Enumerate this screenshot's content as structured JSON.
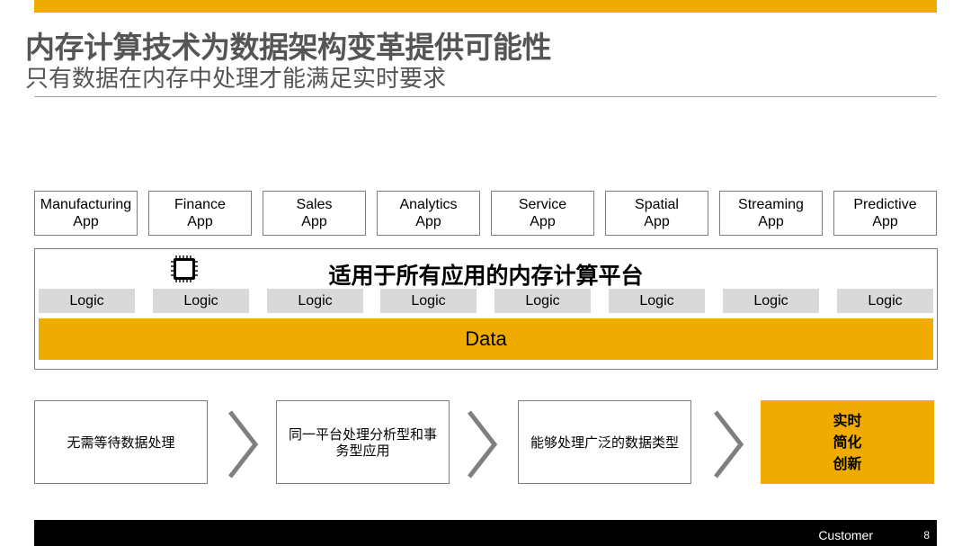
{
  "header": {
    "title": "内存计算技术为数据架构变革提供可能性",
    "subtitle": "只有数据在内存中处理才能满足实时要求"
  },
  "apps": [
    {
      "line1": "Manufacturing",
      "line2": "App"
    },
    {
      "line1": "Finance",
      "line2": "App"
    },
    {
      "line1": "Sales",
      "line2": "App"
    },
    {
      "line1": "Analytics",
      "line2": "App"
    },
    {
      "line1": "Service",
      "line2": "App"
    },
    {
      "line1": "Spatial",
      "line2": "App"
    },
    {
      "line1": "Streaming",
      "line2": "App"
    },
    {
      "line1": "Predictive",
      "line2": "App"
    }
  ],
  "platform": {
    "title": "适用于所有应用的内存计算平台",
    "icon": "chip-icon",
    "logic_labels": [
      "Logic",
      "Logic",
      "Logic",
      "Logic",
      "Logic",
      "Logic",
      "Logic",
      "Logic"
    ],
    "data_label": "Data"
  },
  "steps": [
    {
      "text": "无需等待数据处理"
    },
    {
      "text": "同一平台处理分析型和事务型应用"
    },
    {
      "text": "能够处理广泛的数据类型"
    }
  ],
  "result": {
    "lines": [
      "实时",
      "简化",
      "创新"
    ]
  },
  "footer": {
    "label": "Customer",
    "page": "8"
  },
  "colors": {
    "accent": "#f0ab00",
    "logic_bg": "#d9d9d9",
    "title_text": "#555555",
    "footer_bg": "#000000"
  }
}
